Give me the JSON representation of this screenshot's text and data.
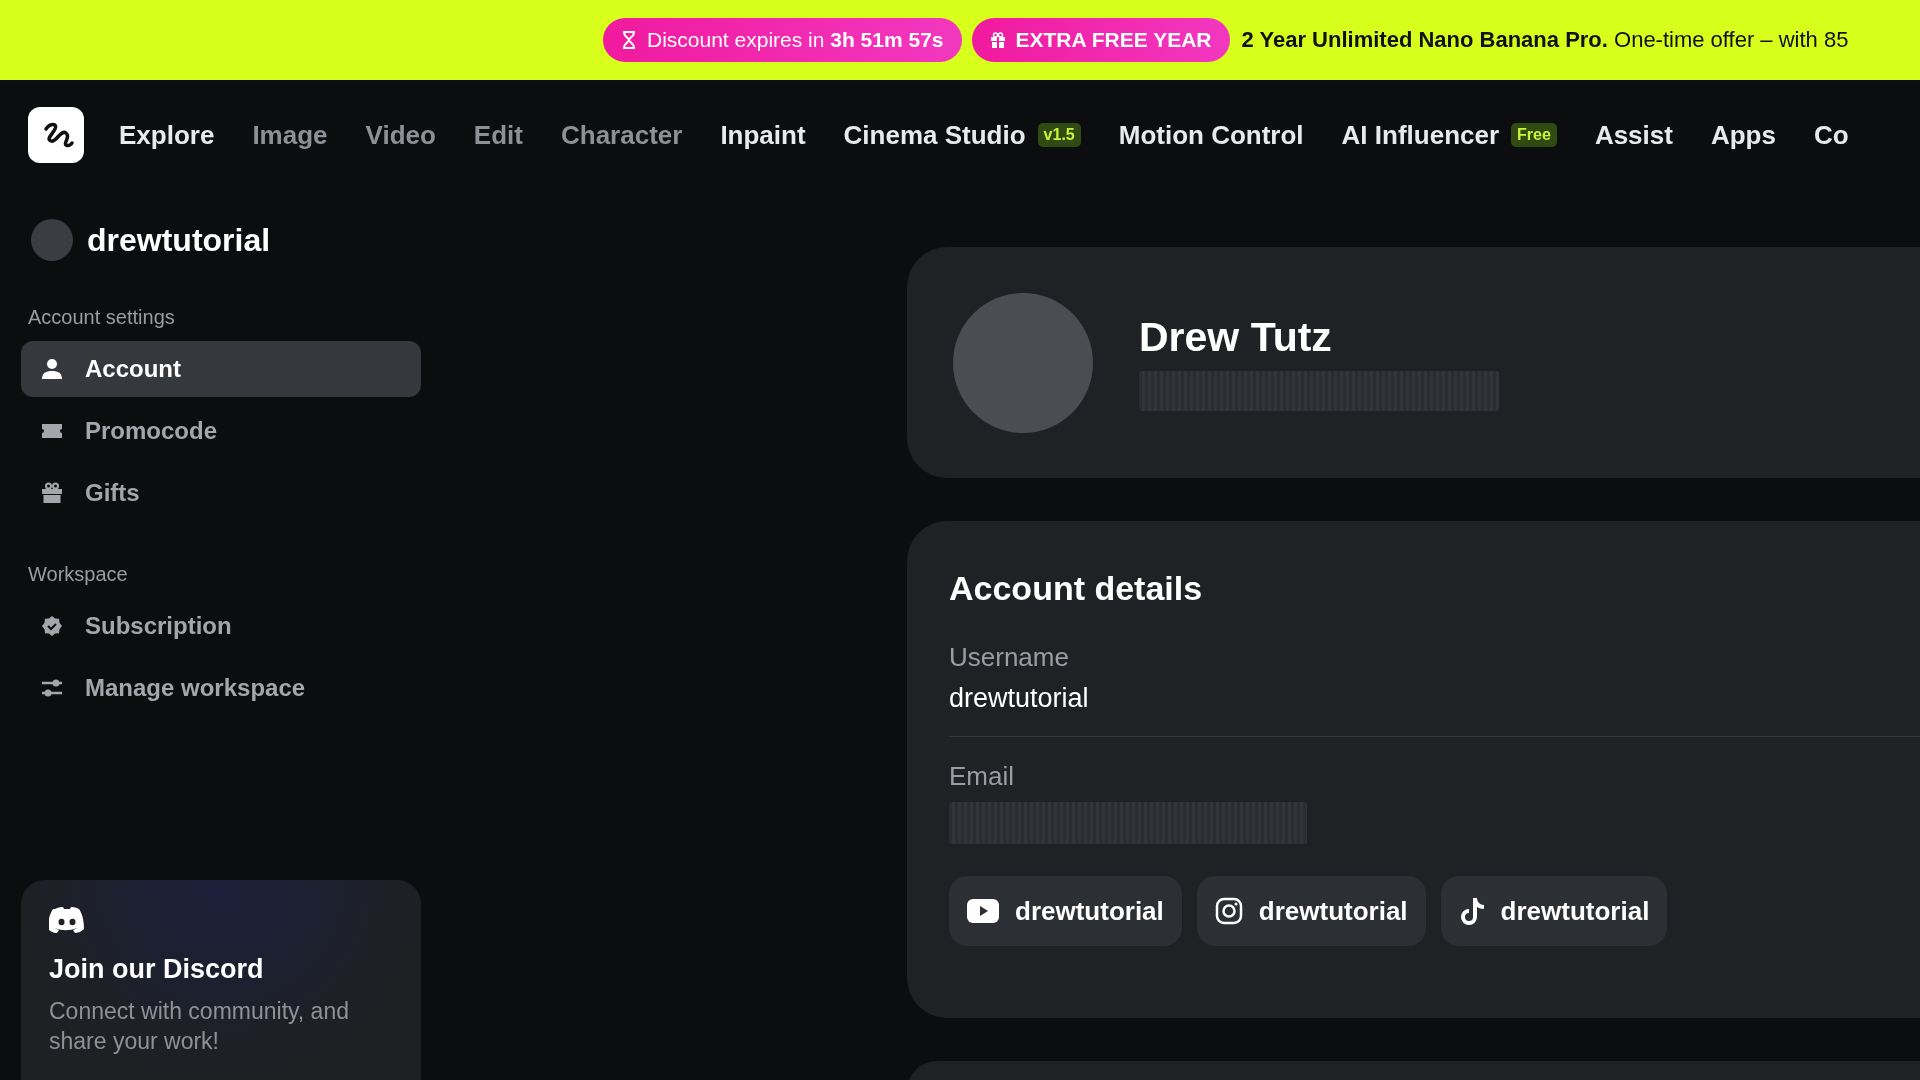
{
  "promo_banner": {
    "timer": "Discount expires in **3h 51m 57s**",
    "offer": "EXTRA FREE YEAR",
    "message": "**2 Year Unlimited Nano Banana Pro.** One-time offer – with 85"
  },
  "nav": {
    "items": [
      {
        "label": "Explore",
        "dimmed": false
      },
      {
        "label": "Image",
        "dimmed": true
      },
      {
        "label": "Video",
        "dimmed": true
      },
      {
        "label": "Edit",
        "dimmed": true
      },
      {
        "label": "Character",
        "dimmed": true
      },
      {
        "label": "Inpaint",
        "dimmed": false
      },
      {
        "label": "Cinema Studio",
        "dimmed": false,
        "badge": "v1.5"
      },
      {
        "label": "Motion Control",
        "dimmed": false
      },
      {
        "label": "AI Influencer",
        "dimmed": false,
        "badge": "Free"
      },
      {
        "label": "Assist",
        "dimmed": false
      },
      {
        "label": "Apps",
        "dimmed": false
      },
      {
        "label": "Co",
        "dimmed": false
      }
    ]
  },
  "sidebar": {
    "username": "drewtutorial",
    "sections": [
      {
        "title": "Account settings",
        "items": [
          {
            "label": "Account",
            "selected": true
          },
          {
            "label": "Promocode",
            "selected": false
          },
          {
            "label": "Gifts",
            "selected": false
          }
        ]
      },
      {
        "title": "Workspace",
        "items": [
          {
            "label": "Subscription",
            "selected": false
          },
          {
            "label": "Manage workspace",
            "selected": false
          }
        ]
      }
    ],
    "discord": {
      "title": "Join our Discord",
      "text": "Connect with community, and share your work!"
    }
  },
  "profile": {
    "name": "Drew Tutz"
  },
  "account_details": {
    "title": "Account details",
    "fields": [
      {
        "label": "Username",
        "value": "drewtutorial"
      },
      {
        "label": "Email"
      }
    ],
    "socials": [
      {
        "kind": "video",
        "label": "drewtutorial"
      },
      {
        "kind": "photo",
        "label": "drewtutorial"
      },
      {
        "kind": "music",
        "label": "drewtutorial"
      }
    ]
  }
}
